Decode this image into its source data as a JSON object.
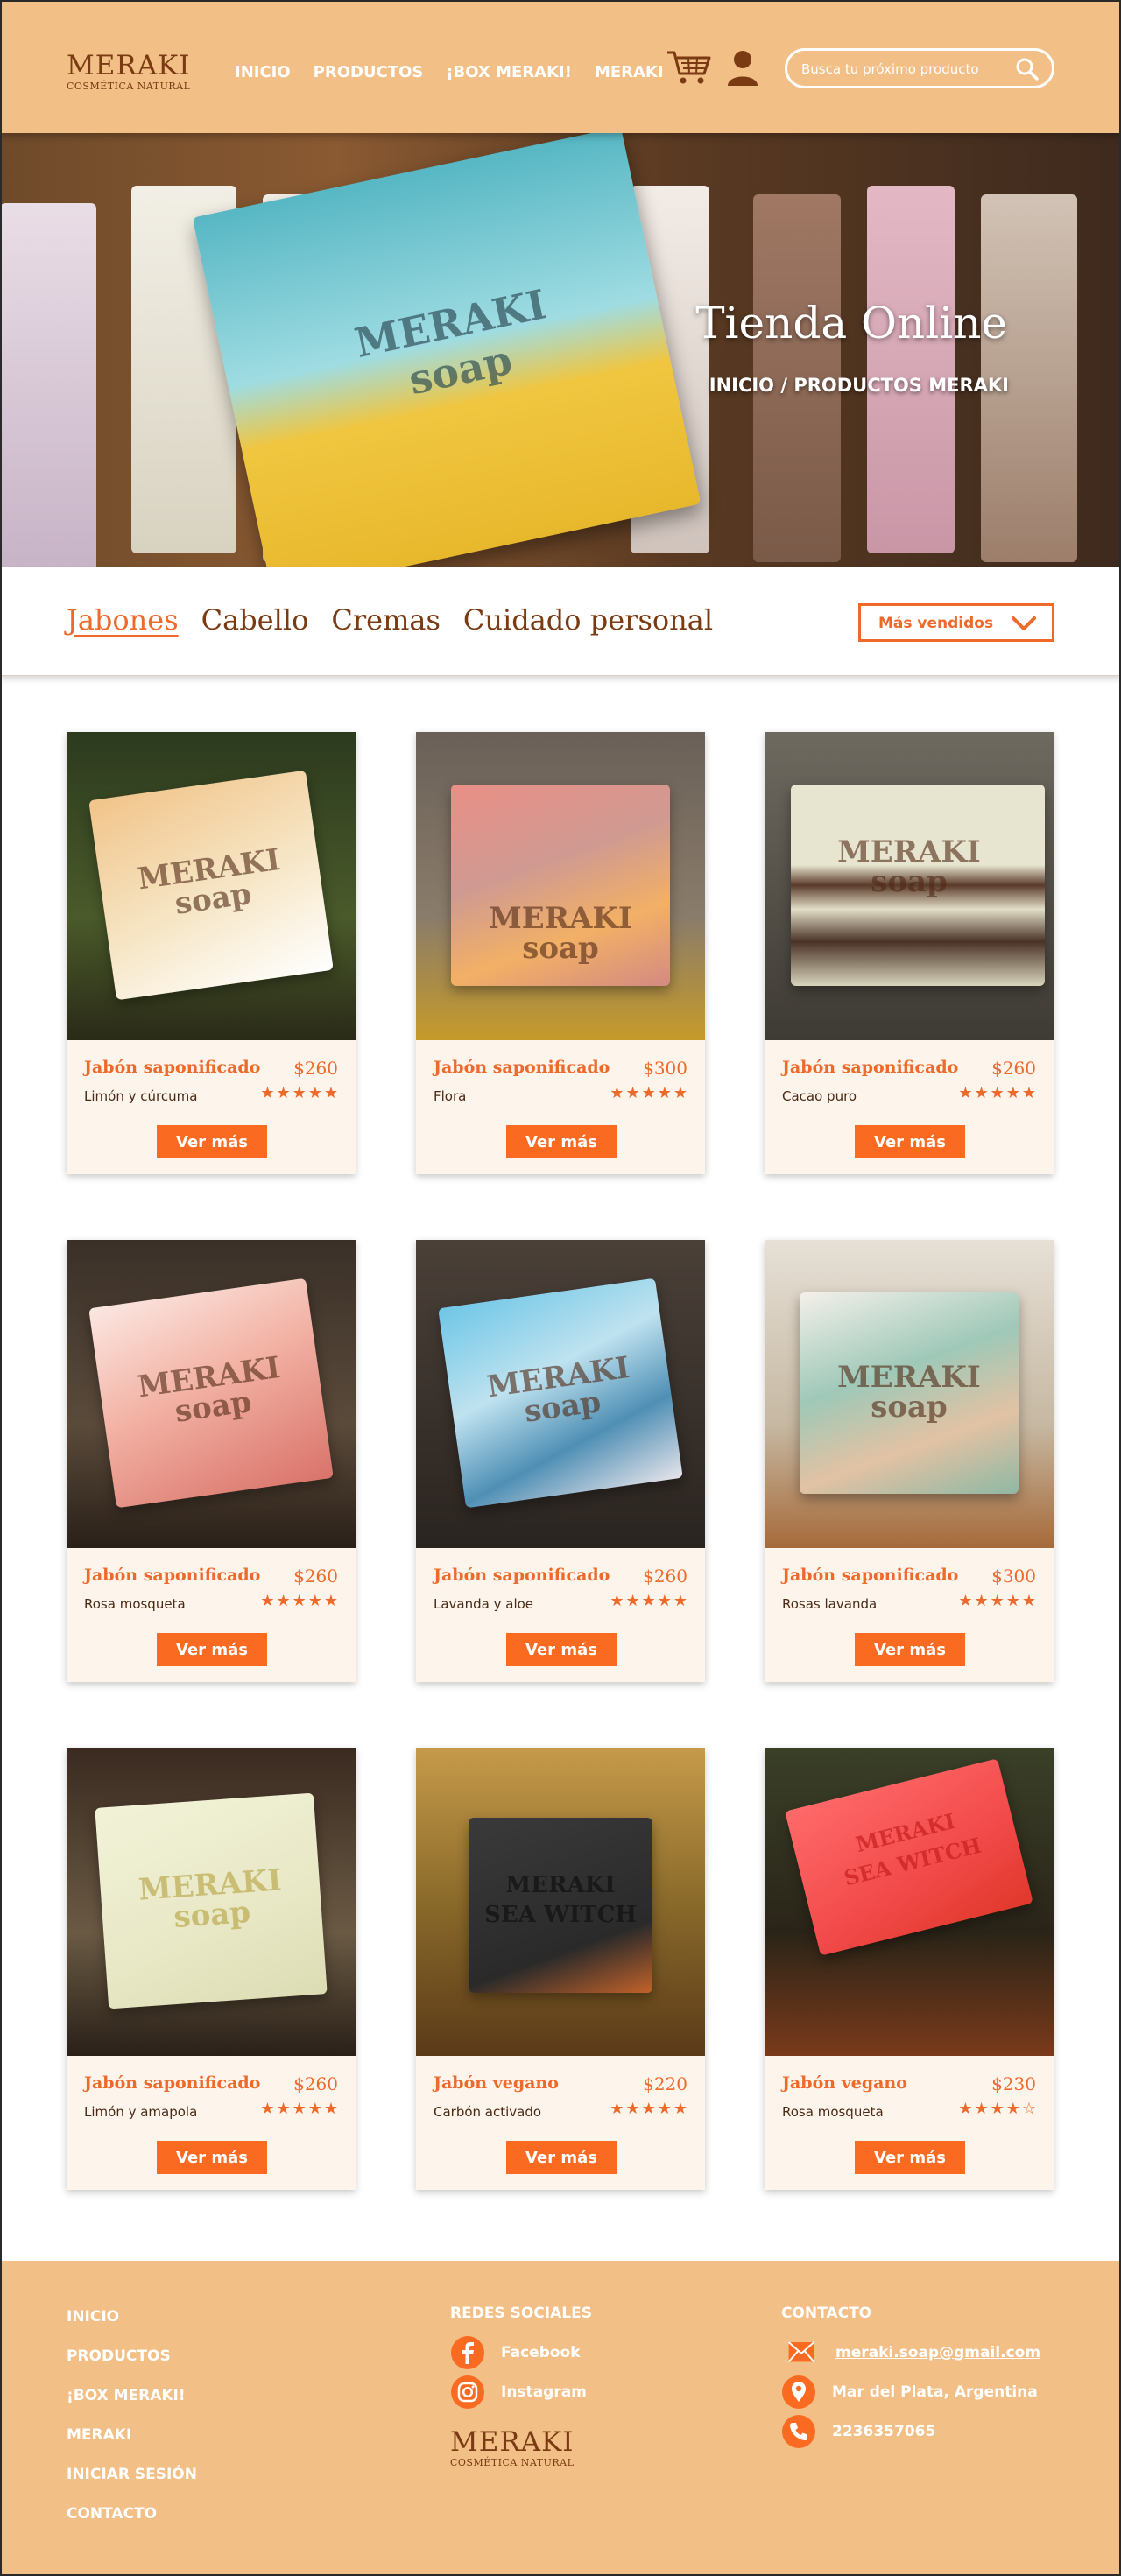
{
  "header": {
    "logo_name": "MERAKI",
    "logo_sub": "COSMÉTICA NATURAL",
    "nav": [
      "INICIO",
      "PRODUCTOS",
      "¡BOX MERAKI!",
      "MERAKI"
    ],
    "search_placeholder": "Busca tu próximo producto",
    "icons": [
      "cart-icon",
      "user-icon",
      "search-icon"
    ]
  },
  "hero": {
    "title": "Tienda Online",
    "breadcrumb": "INICIO / PRODUCTOS MERAKI",
    "image_text": "MERAKI soap"
  },
  "categories": {
    "tabs": [
      "Jabones",
      "Cabello",
      "Cremas",
      "Cuidado personal"
    ],
    "active": "Jabones",
    "sort_label": "Más vendidos"
  },
  "products": [
    {
      "title": "Jabón saponificado",
      "price": "$260",
      "variant": "Limón y cúrcuma",
      "stars": "★★★★★",
      "rating": 5,
      "button": "Ver más"
    },
    {
      "title": "Jabón saponificado",
      "price": "$300",
      "variant": "Flora",
      "stars": "★★★★★",
      "rating": 5,
      "button": "Ver más"
    },
    {
      "title": "Jabón saponificado",
      "price": "$260",
      "variant": "Cacao puro",
      "stars": "★★★★★",
      "rating": 5,
      "button": "Ver más"
    },
    {
      "title": "Jabón saponificado",
      "price": "$260",
      "variant": "Rosa mosqueta",
      "stars": "★★★★★",
      "rating": 5,
      "button": "Ver más"
    },
    {
      "title": "Jabón saponificado",
      "price": "$260",
      "variant": "Lavanda y aloe",
      "stars": "★★★★★",
      "rating": 5,
      "button": "Ver más"
    },
    {
      "title": "Jabón saponificado",
      "price": "$300",
      "variant": "Rosas lavanda",
      "stars": "★★★★★",
      "rating": 5,
      "button": "Ver más"
    },
    {
      "title": "Jabón saponificado",
      "price": "$260",
      "variant": "Limón y amapola",
      "stars": "★★★★★",
      "rating": 5,
      "button": "Ver más"
    },
    {
      "title": "Jabón vegano",
      "price": "$220",
      "variant": "Carbón activado",
      "stars": "★★★★★",
      "rating": 5,
      "button": "Ver más"
    },
    {
      "title": "Jabón vegano",
      "price": "$230",
      "variant": "Rosa mosqueta",
      "stars": "★★★★☆",
      "rating": 4,
      "button": "Ver más"
    }
  ],
  "footer": {
    "links": [
      "INICIO",
      "PRODUCTOS",
      "¡BOX MERAKI!",
      "MERAKI",
      "INICIAR SESIÓN",
      "CONTACTO"
    ],
    "social_heading": "REDES SOCIALES",
    "social": [
      "Facebook",
      "Instagram"
    ],
    "contact_heading": "CONTACTO",
    "contact": [
      "meraki.soap@gmail.com",
      "Mar del Plata, Argentina",
      "2236357065"
    ]
  },
  "colors": {
    "header_bg": "#f2bf87",
    "accent": "#ee6a2b",
    "button": "#fb6a21",
    "brown": "#7a3a12",
    "card_bg": "#fdf4ec"
  }
}
